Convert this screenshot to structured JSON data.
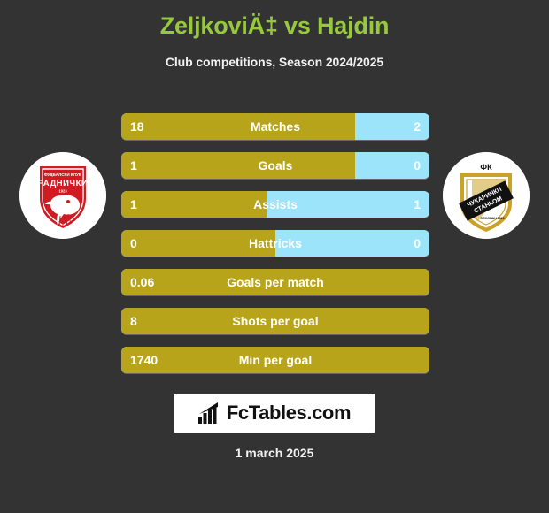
{
  "header": {
    "title": "ZeljkoviÄ‡ vs Hajdin",
    "subtitle": "Club competitions, Season 2024/2025"
  },
  "teams": {
    "left": {
      "crest_name": "fk-radnicki-crest",
      "crest_top_text": "ФУДБАЛСКИ КЛУБ",
      "crest_main_text": "РАДНИЧКИ",
      "crest_year": "1923"
    },
    "right": {
      "crest_name": "fk-cukaricki-stankom-crest",
      "crest_top_text": "ФК",
      "crest_main_text_1": "ЧУКАРИЧКИ",
      "crest_main_text_2": "СТАНКОМ",
      "crest_sub_text": "ОСНОВАН 1926"
    }
  },
  "stats": [
    {
      "label": "Matches",
      "left": "18",
      "right": "2",
      "left_pct": 76,
      "has_right": true
    },
    {
      "label": "Goals",
      "left": "1",
      "right": "0",
      "left_pct": 76,
      "has_right": true
    },
    {
      "label": "Assists",
      "left": "1",
      "right": "1",
      "left_pct": 47,
      "has_right": true
    },
    {
      "label": "Hattricks",
      "left": "0",
      "right": "0",
      "left_pct": 50,
      "has_right": true
    },
    {
      "label": "Goals per match",
      "left": "0.06",
      "right": "",
      "left_pct": 100,
      "has_right": false
    },
    {
      "label": "Shots per goal",
      "left": "8",
      "right": "",
      "left_pct": 100,
      "has_right": false
    },
    {
      "label": "Min per goal",
      "left": "1740",
      "right": "",
      "left_pct": 100,
      "has_right": false
    }
  ],
  "footer": {
    "brand": "FcTables.com",
    "brand_icon": "bar-chart-icon",
    "date": "1 march 2025"
  },
  "colors": {
    "background": "#333333",
    "title": "#97c93d",
    "bar_left": "#b8a41a",
    "bar_right": "#9ce4fa",
    "text": "#ffffff"
  }
}
